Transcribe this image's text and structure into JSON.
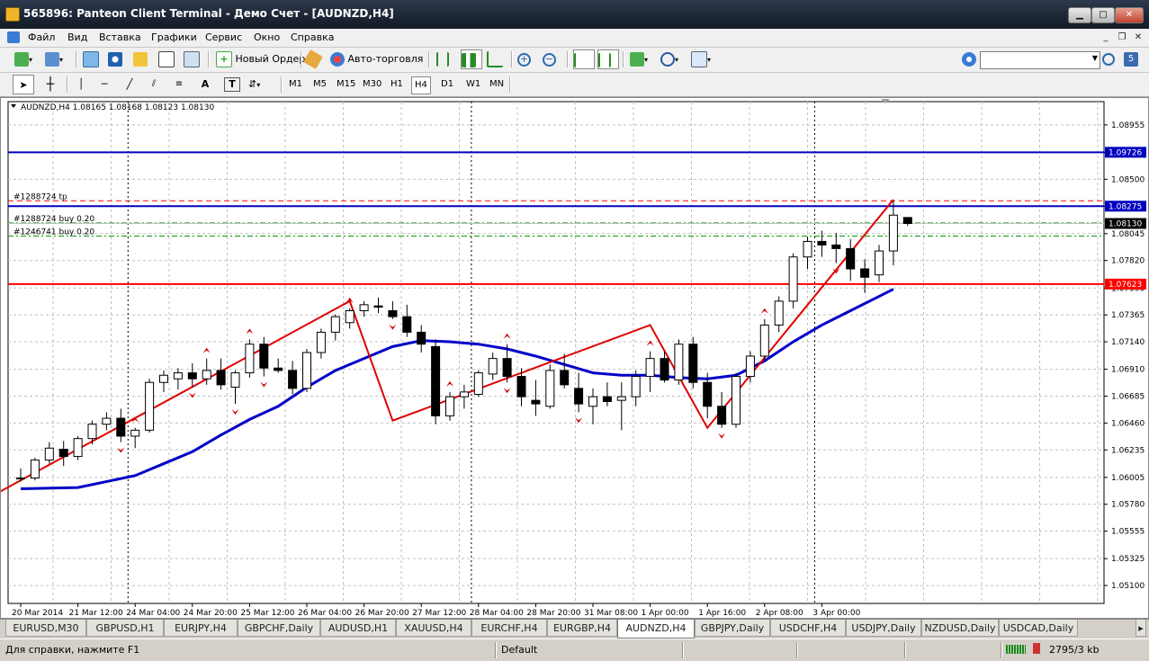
{
  "window": {
    "title": "565896: Panteon Client Terminal - Демо Счет - [AUDNZD,H4]"
  },
  "menu": [
    "Файл",
    "Вид",
    "Вставка",
    "Графики",
    "Сервис",
    "Окно",
    "Справка"
  ],
  "toolbar": {
    "new_order": "Новый Ордер",
    "autotrading": "Авто-торговля"
  },
  "timeframes": [
    "M1",
    "M5",
    "M15",
    "M30",
    "H1",
    "H4",
    "D1",
    "W1",
    "MN"
  ],
  "active_timeframe": "H4",
  "chart_data": {
    "type": "candlestick",
    "title": "AUDNZD,H4",
    "ohlc_header": "1.08165 1.08168 1.08123 1.08130",
    "ylim": [
      1.0495,
      1.0915
    ],
    "price_ticks": [
      "1.08955",
      "1.08725",
      "1.08500",
      "1.08275",
      "1.08045",
      "1.07820",
      "1.07590",
      "1.07365",
      "1.07140",
      "1.06910",
      "1.06685",
      "1.06460",
      "1.06235",
      "1.06005",
      "1.05780",
      "1.05555",
      "1.05325",
      "1.05100"
    ],
    "price_tick_values": [
      1.08955,
      1.08725,
      1.085,
      1.08275,
      1.08045,
      1.0782,
      1.0759,
      1.07365,
      1.0714,
      1.0691,
      1.06685,
      1.0646,
      1.06235,
      1.06005,
      1.0578,
      1.05555,
      1.05325,
      1.051
    ],
    "date_labels": [
      "20 Mar 2014",
      "21 Mar 12:00",
      "24 Mar 04:00",
      "24 Mar 20:00",
      "25 Mar 12:00",
      "26 Mar 04:00",
      "26 Mar 20:00",
      "27 Mar 12:00",
      "28 Mar 04:00",
      "28 Mar 20:00",
      "31 Mar 08:00",
      "1 Apr 00:00",
      "1 Apr 16:00",
      "2 Apr 08:00",
      "3 Apr 00:00"
    ],
    "date_label_bars": [
      0,
      4,
      8,
      12,
      16,
      20,
      24,
      28,
      32,
      36,
      40,
      44,
      48,
      52,
      56
    ],
    "candles": [
      [
        1.06,
        1.0608,
        1.0597,
        1.06
      ],
      [
        1.06,
        1.0617,
        1.0598,
        1.0615
      ],
      [
        1.0615,
        1.063,
        1.0612,
        1.0625
      ],
      [
        1.0624,
        1.0631,
        1.061,
        1.0618
      ],
      [
        1.0618,
        1.0635,
        1.0615,
        1.0633
      ],
      [
        1.0633,
        1.0648,
        1.0628,
        1.0645
      ],
      [
        1.0645,
        1.0655,
        1.064,
        1.065
      ],
      [
        1.065,
        1.0658,
        1.063,
        1.0635
      ],
      [
        1.0635,
        1.0642,
        1.0625,
        1.064
      ],
      [
        1.064,
        1.0683,
        1.0638,
        1.068
      ],
      [
        1.068,
        1.069,
        1.0672,
        1.0686
      ],
      [
        1.0683,
        1.0692,
        1.0674,
        1.0688
      ],
      [
        1.0688,
        1.0696,
        1.0676,
        1.0683
      ],
      [
        1.0683,
        1.07,
        1.0678,
        1.069
      ],
      [
        1.069,
        1.07,
        1.0674,
        1.0678
      ],
      [
        1.0676,
        1.069,
        1.0662,
        1.0688
      ],
      [
        1.0688,
        1.0716,
        1.0684,
        1.0712
      ],
      [
        1.0712,
        1.0718,
        1.0685,
        1.0692
      ],
      [
        1.0692,
        1.07,
        1.0688,
        1.069
      ],
      [
        1.069,
        1.0698,
        1.067,
        1.0675
      ],
      [
        1.0675,
        1.0708,
        1.0672,
        1.0705
      ],
      [
        1.0705,
        1.0725,
        1.07,
        1.0722
      ],
      [
        1.0722,
        1.0737,
        1.0715,
        1.0735
      ],
      [
        1.073,
        1.0742,
        1.0725,
        1.074
      ],
      [
        1.074,
        1.0748,
        1.0735,
        1.0745
      ],
      [
        1.0744,
        1.0751,
        1.0738,
        1.0743
      ],
      [
        1.074,
        1.0748,
        1.0733,
        1.0735
      ],
      [
        1.0735,
        1.0745,
        1.0718,
        1.0722
      ],
      [
        1.0722,
        1.0728,
        1.0705,
        1.0712
      ],
      [
        1.071,
        1.0716,
        1.0645,
        1.0652
      ],
      [
        1.0652,
        1.0672,
        1.0648,
        1.0668
      ],
      [
        1.0668,
        1.0678,
        1.0658,
        1.0672
      ],
      [
        1.067,
        1.069,
        1.0668,
        1.0688
      ],
      [
        1.0687,
        1.0705,
        1.0682,
        1.07
      ],
      [
        1.07,
        1.0712,
        1.068,
        1.0685
      ],
      [
        1.0685,
        1.0692,
        1.066,
        1.0668
      ],
      [
        1.0665,
        1.0682,
        1.0652,
        1.0662
      ],
      [
        1.066,
        1.0695,
        1.0658,
        1.069
      ],
      [
        1.069,
        1.0704,
        1.0675,
        1.0678
      ],
      [
        1.0675,
        1.0688,
        1.0655,
        1.0662
      ],
      [
        1.066,
        1.0675,
        1.0645,
        1.0668
      ],
      [
        1.0668,
        1.068,
        1.066,
        1.0664
      ],
      [
        1.0665,
        1.068,
        1.064,
        1.0668
      ],
      [
        1.0668,
        1.069,
        1.066,
        1.0685
      ],
      [
        1.0685,
        1.0706,
        1.0672,
        1.07
      ],
      [
        1.07,
        1.0706,
        1.068,
        1.0682
      ],
      [
        1.0682,
        1.0716,
        1.0678,
        1.0712
      ],
      [
        1.0712,
        1.0718,
        1.0675,
        1.068
      ],
      [
        1.068,
        1.0688,
        1.065,
        1.066
      ],
      [
        1.066,
        1.0672,
        1.0642,
        1.0645
      ],
      [
        1.0645,
        1.0688,
        1.0642,
        1.0685
      ],
      [
        1.0685,
        1.0706,
        1.068,
        1.0702
      ],
      [
        1.0702,
        1.0733,
        1.0698,
        1.0728
      ],
      [
        1.0728,
        1.0752,
        1.0722,
        1.0748
      ],
      [
        1.0748,
        1.0788,
        1.0742,
        1.0785
      ],
      [
        1.0785,
        1.0802,
        1.0775,
        1.0798
      ],
      [
        1.0798,
        1.0807,
        1.0785,
        1.0795
      ],
      [
        1.0795,
        1.0805,
        1.078,
        1.0792
      ],
      [
        1.0792,
        1.08,
        1.0765,
        1.0775
      ],
      [
        1.0775,
        1.0783,
        1.0755,
        1.0768
      ],
      [
        1.077,
        1.0795,
        1.0764,
        1.079
      ],
      [
        1.079,
        1.0832,
        1.0778,
        1.082
      ],
      [
        1.0818,
        1.0818,
        1.0811,
        1.0813
      ]
    ],
    "ma_series": [
      [
        0,
        1.0591
      ],
      [
        4,
        1.0592
      ],
      [
        8,
        1.0602
      ],
      [
        10,
        1.0612
      ],
      [
        12,
        1.0622
      ],
      [
        14,
        1.0636
      ],
      [
        16,
        1.0649
      ],
      [
        18,
        1.066
      ],
      [
        20,
        1.0676
      ],
      [
        22,
        1.069
      ],
      [
        24,
        1.07
      ],
      [
        26,
        1.071
      ],
      [
        28,
        1.0715
      ],
      [
        30,
        1.0714
      ],
      [
        32,
        1.0712
      ],
      [
        34,
        1.0708
      ],
      [
        36,
        1.0702
      ],
      [
        38,
        1.0695
      ],
      [
        40,
        1.0688
      ],
      [
        42,
        1.0686
      ],
      [
        44,
        1.0686
      ],
      [
        46,
        1.0684
      ],
      [
        48,
        1.0683
      ],
      [
        50,
        1.0686
      ],
      [
        52,
        1.0698
      ],
      [
        54,
        1.0714
      ],
      [
        56,
        1.0728
      ],
      [
        58,
        1.074
      ],
      [
        60,
        1.0752
      ],
      [
        61,
        1.0758
      ]
    ],
    "zigzag": [
      [
        -2,
        1.0585
      ],
      [
        23,
        1.0748
      ],
      [
        26,
        1.0648
      ],
      [
        44,
        1.0728
      ],
      [
        48,
        1.0642
      ],
      [
        61,
        1.0833
      ]
    ],
    "fractals_up": [
      8,
      13,
      16,
      23,
      30,
      34,
      44,
      52
    ],
    "fractals_down": [
      7,
      12,
      15,
      17,
      26,
      34,
      39,
      49,
      57
    ],
    "hlines": [
      {
        "price": 1.08726,
        "color": "#0000c0",
        "width": 2,
        "style": "solid",
        "label": "1.09726"
      },
      {
        "price": 1.08275,
        "color": "#0000c0",
        "width": 2,
        "style": "solid",
        "label": "1.08275"
      },
      {
        "price": 1.0832,
        "color": "#ff0000",
        "width": 1,
        "style": "dash",
        "label": "#1288724 tp"
      },
      {
        "price": 1.08135,
        "color": "#00a000",
        "width": 1,
        "style": "dashdot",
        "label": "#1288724 buy 0.20"
      },
      {
        "price": 1.08025,
        "color": "#00a000",
        "width": 1,
        "style": "dashdot",
        "label": "#1246741 buy 0.20"
      },
      {
        "price": 1.07623,
        "color": "#ff0000",
        "width": 2,
        "style": "solid",
        "label": "1.07623"
      }
    ],
    "current_price_label": "1.08130",
    "current_price": 1.0813
  },
  "tabs": [
    "EURUSD,M30",
    "GBPUSD,H1",
    "EURJPY,H4",
    "GBPCHF,Daily",
    "AUDUSD,H1",
    "XAUUSD,H4",
    "EURCHF,H4",
    "EURGBP,H4",
    "AUDNZD,H4",
    "GBPJPY,Daily",
    "USDCHF,H4",
    "USDJPY,Daily",
    "NZDUSD,Daily",
    "USDCAD,Daily"
  ],
  "active_tab": "AUDNZD,H4",
  "status": {
    "help": "Для справки, нажмите F1",
    "profile": "Default",
    "traffic": "2795/3 kb"
  },
  "colors": {
    "bull": "#ffffff",
    "bear": "#000000",
    "ma": "#0000c8",
    "zigzag": "#e00000",
    "fractal": "#d00000",
    "grid": "#c0c0c0"
  }
}
